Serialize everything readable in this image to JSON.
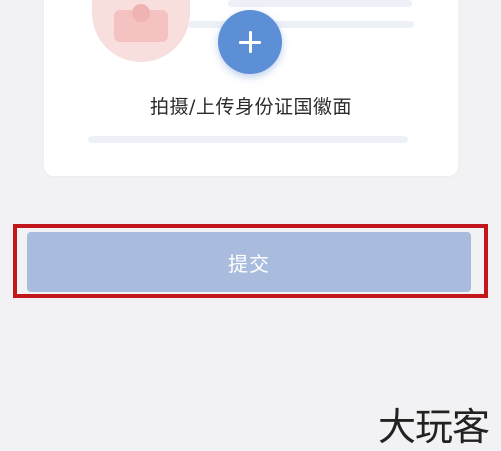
{
  "upload": {
    "plus_icon": "plus-icon",
    "label": "拍摄/上传身份证国徽面"
  },
  "submit": {
    "label": "提交",
    "highlight_color": "#c2161a",
    "button_color": "#a9bcdd"
  },
  "watermark": {
    "text": "大玩客"
  },
  "colors": {
    "accent": "#5d8fd6",
    "background": "#f2f2f4"
  }
}
